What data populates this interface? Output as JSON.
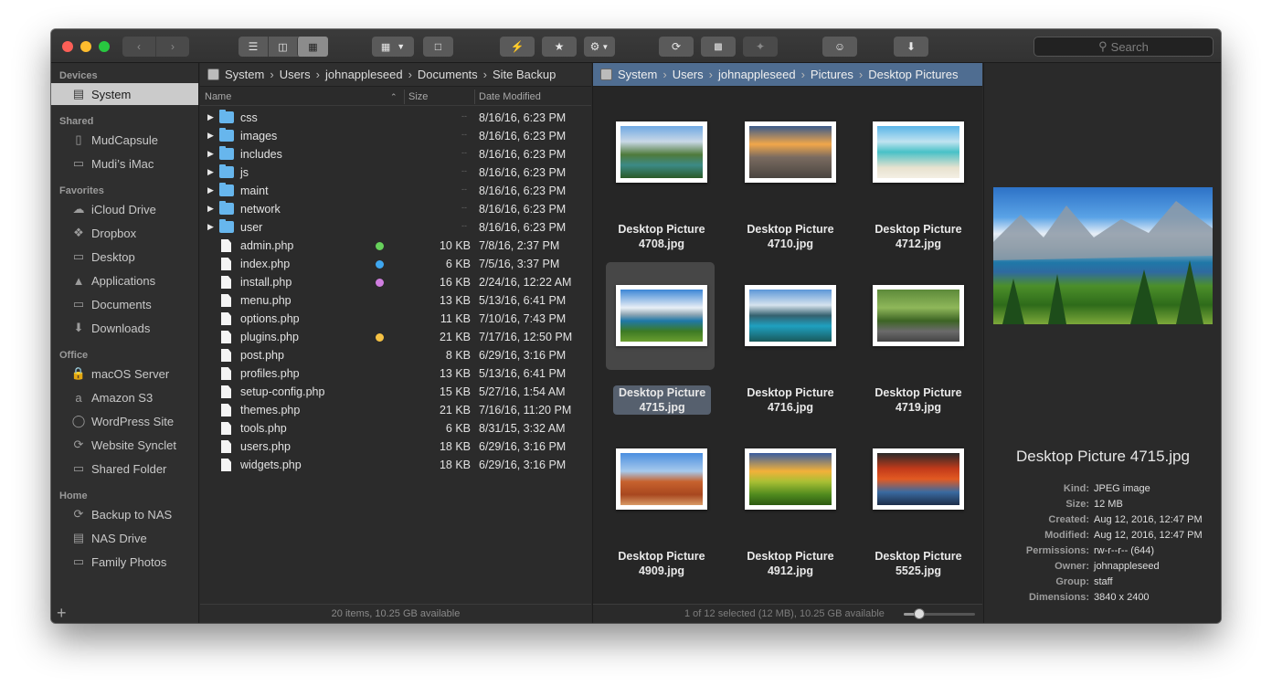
{
  "toolbar": {
    "search_placeholder": "Search"
  },
  "sidebar": {
    "sections": [
      {
        "title": "Devices",
        "items": [
          {
            "label": "System",
            "icon": "hard-drive-icon",
            "selected": true
          }
        ]
      },
      {
        "title": "Shared",
        "items": [
          {
            "label": "MudCapsule",
            "icon": "time-capsule-icon"
          },
          {
            "label": "Mudi’s iMac",
            "icon": "imac-icon"
          }
        ]
      },
      {
        "title": "Favorites",
        "items": [
          {
            "label": "iCloud Drive",
            "icon": "cloud-icon"
          },
          {
            "label": "Dropbox",
            "icon": "dropbox-icon"
          },
          {
            "label": "Desktop",
            "icon": "folder-icon"
          },
          {
            "label": "Applications",
            "icon": "applications-icon"
          },
          {
            "label": "Documents",
            "icon": "folder-icon"
          },
          {
            "label": "Downloads",
            "icon": "download-icon"
          }
        ]
      },
      {
        "title": "Office",
        "items": [
          {
            "label": "macOS Server",
            "icon": "lock-icon"
          },
          {
            "label": "Amazon S3",
            "icon": "amazon-icon"
          },
          {
            "label": "WordPress Site",
            "icon": "globe-icon"
          },
          {
            "label": "Website Synclet",
            "icon": "sync-icon"
          },
          {
            "label": "Shared Folder",
            "icon": "folder-icon"
          }
        ]
      },
      {
        "title": "Home",
        "items": [
          {
            "label": "Backup to NAS",
            "icon": "sync-icon"
          },
          {
            "label": "NAS Drive",
            "icon": "nas-icon"
          },
          {
            "label": "Family Photos",
            "icon": "folder-icon"
          }
        ]
      }
    ]
  },
  "left_pane": {
    "path": [
      "System",
      "Users",
      "johnappleseed",
      "Documents",
      "Site Backup"
    ],
    "columns": {
      "name": "Name",
      "size": "Size",
      "date": "Date Modified"
    },
    "rows": [
      {
        "name": "css",
        "type": "folder",
        "size": "--",
        "date": "8/16/16, 6:23 PM"
      },
      {
        "name": "images",
        "type": "folder",
        "size": "--",
        "date": "8/16/16, 6:23 PM"
      },
      {
        "name": "includes",
        "type": "folder",
        "size": "--",
        "date": "8/16/16, 6:23 PM"
      },
      {
        "name": "js",
        "type": "folder",
        "size": "--",
        "date": "8/16/16, 6:23 PM"
      },
      {
        "name": "maint",
        "type": "folder",
        "size": "--",
        "date": "8/16/16, 6:23 PM"
      },
      {
        "name": "network",
        "type": "folder",
        "size": "--",
        "date": "8/16/16, 6:23 PM"
      },
      {
        "name": "user",
        "type": "folder",
        "size": "--",
        "date": "8/16/16, 6:23 PM"
      },
      {
        "name": "admin.php",
        "type": "file",
        "size": "10 KB",
        "date": "7/8/16, 2:37 PM",
        "tag": "#67d15b"
      },
      {
        "name": "index.php",
        "type": "file",
        "size": "6 KB",
        "date": "7/5/16, 3:37 PM",
        "tag": "#3fa7f0"
      },
      {
        "name": "install.php",
        "type": "file",
        "size": "16 KB",
        "date": "2/24/16, 12:22 AM",
        "tag": "#d07ee0"
      },
      {
        "name": "menu.php",
        "type": "file",
        "size": "13 KB",
        "date": "5/13/16, 6:41 PM"
      },
      {
        "name": "options.php",
        "type": "file",
        "size": "11 KB",
        "date": "7/10/16, 7:43 PM"
      },
      {
        "name": "plugins.php",
        "type": "file",
        "size": "21 KB",
        "date": "7/17/16, 12:50 PM",
        "tag": "#f6c244"
      },
      {
        "name": "post.php",
        "type": "file",
        "size": "8 KB",
        "date": "6/29/16, 3:16 PM"
      },
      {
        "name": "profiles.php",
        "type": "file",
        "size": "13 KB",
        "date": "5/13/16, 6:41 PM"
      },
      {
        "name": "setup-config.php",
        "type": "file",
        "size": "15 KB",
        "date": "5/27/16, 1:54 AM"
      },
      {
        "name": "themes.php",
        "type": "file",
        "size": "21 KB",
        "date": "7/16/16, 11:20 PM"
      },
      {
        "name": "tools.php",
        "type": "file",
        "size": "6 KB",
        "date": "8/31/15, 3:32 AM"
      },
      {
        "name": "users.php",
        "type": "file",
        "size": "18 KB",
        "date": "6/29/16, 3:16 PM"
      },
      {
        "name": "widgets.php",
        "type": "file",
        "size": "18 KB",
        "date": "6/29/16, 3:16 PM"
      }
    ],
    "status": "20 items, 10.25 GB available"
  },
  "right_pane": {
    "path": [
      "System",
      "Users",
      "johnappleseed",
      "Pictures",
      "Desktop Pictures"
    ],
    "items": [
      {
        "line1": "Desktop Picture",
        "line2": "4708.jpg",
        "thumb": "mountain-lake-green"
      },
      {
        "line1": "Desktop Picture",
        "line2": "4710.jpg",
        "thumb": "city-sunset"
      },
      {
        "line1": "Desktop Picture",
        "line2": "4712.jpg",
        "thumb": "tropical-beach"
      },
      {
        "line1": "Desktop Picture",
        "line2": "4715.jpg",
        "thumb": "glacier-lake",
        "selected": true
      },
      {
        "line1": "Desktop Picture",
        "line2": "4716.jpg",
        "thumb": "turquoise-lake"
      },
      {
        "line1": "Desktop Picture",
        "line2": "4719.jpg",
        "thumb": "tree-lined-road"
      },
      {
        "line1": "Desktop Picture",
        "line2": "4909.jpg",
        "thumb": "desert-arch"
      },
      {
        "line1": "Desktop Picture",
        "line2": "4912.jpg",
        "thumb": "green-field-sunset"
      },
      {
        "line1": "Desktop Picture",
        "line2": "5525.jpg",
        "thumb": "autumn-river"
      }
    ],
    "status": "1 of 12 selected (12 MB), 10.25 GB available",
    "icon_size_fraction": 0.22
  },
  "preview": {
    "title": "Desktop Picture 4715.jpg",
    "meta": [
      {
        "k": "Kind:",
        "v": "JPEG image"
      },
      {
        "k": "Size:",
        "v": "12 MB"
      },
      {
        "k": "Created:",
        "v": "Aug 12, 2016, 12:47 PM"
      },
      {
        "k": "Modified:",
        "v": "Aug 12, 2016, 12:47 PM"
      },
      {
        "k": "Permissions:",
        "v": "rw-r--r-- (644)"
      },
      {
        "k": "Owner:",
        "v": "johnappleseed"
      },
      {
        "k": "Group:",
        "v": "staff"
      },
      {
        "k": "Dimensions:",
        "v": "3840 x 2400"
      }
    ]
  }
}
